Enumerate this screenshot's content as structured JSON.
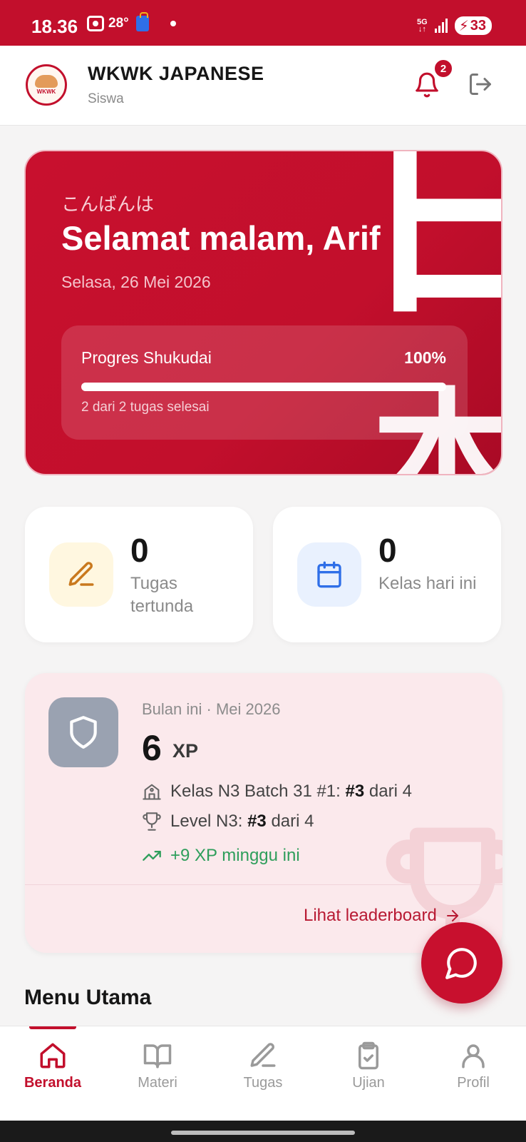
{
  "status_bar": {
    "time": "18.36",
    "temperature": "28°",
    "network": "5G",
    "battery": "33"
  },
  "header": {
    "app_name": "WKWK JAPANESE",
    "role": "Siswa",
    "notification_count": "2",
    "logo_text": "WKWK JAPANESE"
  },
  "hero": {
    "greeting_jp": "こんばんは",
    "greeting": "Selamat malam, Arif",
    "date": "Selasa, 26 Mei 2026",
    "kanji_top": "日",
    "kanji_bottom": "本",
    "progress": {
      "label": "Progres Shukudai",
      "percent_text": "100%",
      "fraction": 1.0,
      "note": "2 dari 2 tugas selesai"
    }
  },
  "stats": [
    {
      "value": "0",
      "label": "Tugas tertunda",
      "icon": "pencil-icon"
    },
    {
      "value": "0",
      "label": "Kelas hari ini",
      "icon": "calendar-icon"
    }
  ],
  "xp_card": {
    "period": "Bulan ini · Mei 2026",
    "xp_value": "6",
    "xp_unit": "XP",
    "class_rank_label": "Kelas N3 Batch 31 #1:",
    "class_rank": "#3",
    "class_rank_total": "dari 4",
    "level_rank_label": "Level N3:",
    "level_rank": "#3",
    "level_rank_total": "dari 4",
    "weekly": "+9 XP minggu ini",
    "leaderboard_link": "Lihat leaderboard"
  },
  "menu_title": "Menu Utama",
  "bottom_nav": [
    {
      "label": "Beranda",
      "icon": "home-icon",
      "active": true
    },
    {
      "label": "Materi",
      "icon": "book-icon",
      "active": false
    },
    {
      "label": "Tugas",
      "icon": "pencil-icon",
      "active": false
    },
    {
      "label": "Ujian",
      "icon": "clipboard-check-icon",
      "active": false
    },
    {
      "label": "Profil",
      "icon": "user-icon",
      "active": false
    }
  ],
  "colors": {
    "brand": "#c20f2c",
    "positive": "#2e9e5b"
  }
}
